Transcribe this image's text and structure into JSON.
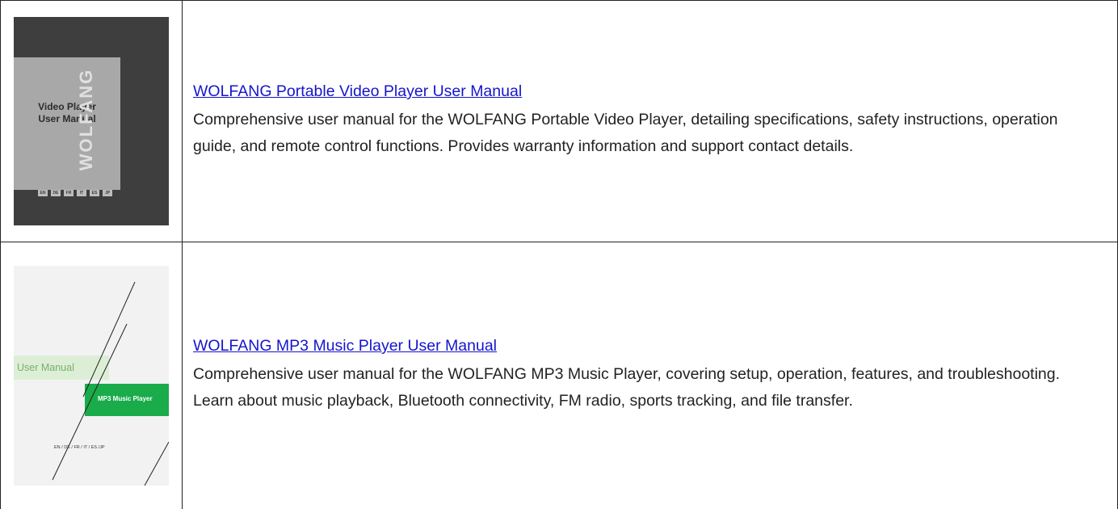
{
  "entries": [
    {
      "title": "WOLFANG Portable Video Player User Manual",
      "description": "Comprehensive user manual for the WOLFANG Portable Video Player, detailing specifications, safety instructions, operation guide, and remote control functions. Provides warranty information and support contact details.",
      "thumbnail": {
        "cover_title_line1": "Video Player",
        "cover_title_line2": "User Manual",
        "brand": "WOLFANG",
        "languages": [
          "EN",
          "DE",
          "FR",
          "IT",
          "ES",
          "JP"
        ]
      }
    },
    {
      "title": "WOLFANG MP3 Music Player User Manual",
      "description": "Comprehensive user manual for the WOLFANG MP3 Music Player, covering setup, operation, features, and troubleshooting. Learn about music playback, Bluetooth connectivity, FM radio, sports tracking, and file transfer.",
      "thumbnail": {
        "band_label": "User Manual",
        "product_label": "MP3 Music Player",
        "languages": "EN / DE / FR / IT / ES /JP"
      }
    }
  ],
  "colors": {
    "link": "#1515cc",
    "border": "#222222",
    "video_cover_bg": "#3e3e3e",
    "video_cover_panel": "#a8a8a8",
    "mp3_cover_bg": "#f2f2f2",
    "mp3_green": "#1aab4b",
    "mp3_band": "#dcefd6"
  }
}
